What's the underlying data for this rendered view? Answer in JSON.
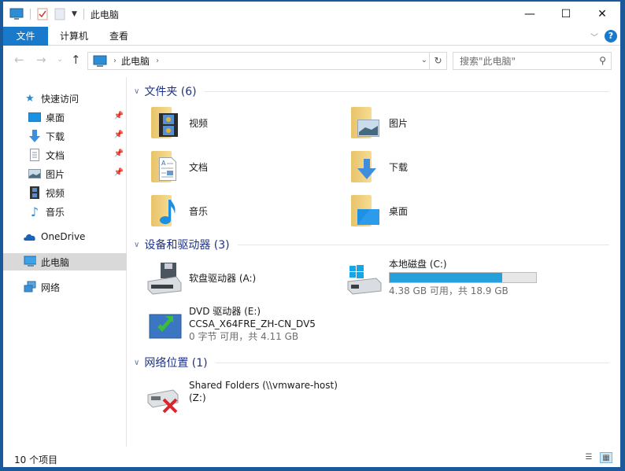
{
  "window": {
    "title": "此电脑",
    "controls": {
      "minimize": "—",
      "maximize": "☐",
      "close": "✕"
    }
  },
  "ribbon": {
    "tabs": [
      {
        "label": "文件",
        "active": true
      },
      {
        "label": "计算机",
        "active": false
      },
      {
        "label": "查看",
        "active": false
      }
    ],
    "help": "?"
  },
  "nav": {
    "back": "←",
    "forward": "→",
    "recent": "⌄",
    "up": "↑",
    "address_crumbs": [
      "此电脑"
    ],
    "refresh": "↻",
    "search_placeholder": "搜索\"此电脑\""
  },
  "sidebar": {
    "quick_access": "快速访问",
    "quick_items": [
      {
        "label": "桌面",
        "icon": "desktop-icon",
        "pinned": true
      },
      {
        "label": "下载",
        "icon": "download-icon",
        "pinned": true
      },
      {
        "label": "文档",
        "icon": "document-icon",
        "pinned": true
      },
      {
        "label": "图片",
        "icon": "pictures-icon",
        "pinned": true
      },
      {
        "label": "视频",
        "icon": "videos-icon",
        "pinned": false
      },
      {
        "label": "音乐",
        "icon": "music-icon",
        "pinned": false
      }
    ],
    "onedrive": "OneDrive",
    "this_pc": "此电脑",
    "network": "网络"
  },
  "main": {
    "folders_group": "文件夹 (6)",
    "folders": [
      {
        "label": "视频",
        "icon": "videos-folder-icon"
      },
      {
        "label": "图片",
        "icon": "pictures-folder-icon"
      },
      {
        "label": "文档",
        "icon": "documents-folder-icon"
      },
      {
        "label": "下载",
        "icon": "downloads-folder-icon"
      },
      {
        "label": "音乐",
        "icon": "music-folder-icon"
      },
      {
        "label": "桌面",
        "icon": "desktop-folder-icon"
      }
    ],
    "devices_group": "设备和驱动器 (3)",
    "floppy": {
      "name": "软盘驱动器 (A:)"
    },
    "local_disk": {
      "name": "本地磁盘 (C:)",
      "used_fraction": 0.768,
      "free_text": "4.38 GB 可用，共 18.9 GB"
    },
    "dvd": {
      "name": "DVD 驱动器 (E:)",
      "volume": "CCSA_X64FRE_ZH-CN_DV5",
      "free_text": "0 字节 可用，共 4.11 GB"
    },
    "network_group": "网络位置 (1)",
    "network_drive": {
      "name": "Shared Folders (\\\\vmware-host)",
      "letter": "(Z:)"
    }
  },
  "status": {
    "item_count": "10 个项目"
  }
}
